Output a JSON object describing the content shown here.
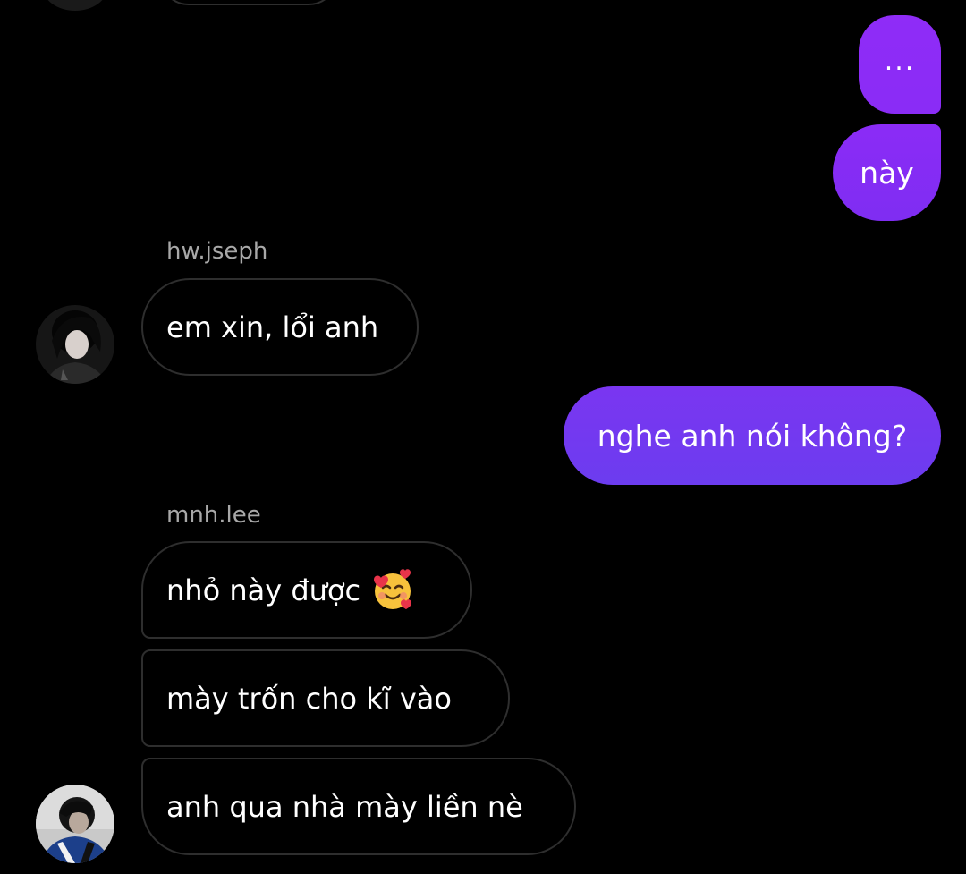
{
  "colors": {
    "sent_bubble_top": "#8a2cf6",
    "sent_bubble_bottom": "#7a2df0",
    "sent_bubble_mid": "#7338f0",
    "received_border": "#2e2e2e",
    "sender_name": "#a8a8a8"
  },
  "messages": {
    "sent_1": "...",
    "sent_2": "này",
    "sender_1": "hw.jseph",
    "recv_1": "em xin, lổi anh",
    "sent_3": "nghe anh nói không?",
    "sender_2": "mnh.lee",
    "recv_2": "nhỏ này được",
    "recv_2_emoji": "smiling-face-with-hearts-icon",
    "recv_3": "mày trốn cho kĩ vào",
    "recv_4": "anh qua nhà mày liền nè"
  }
}
